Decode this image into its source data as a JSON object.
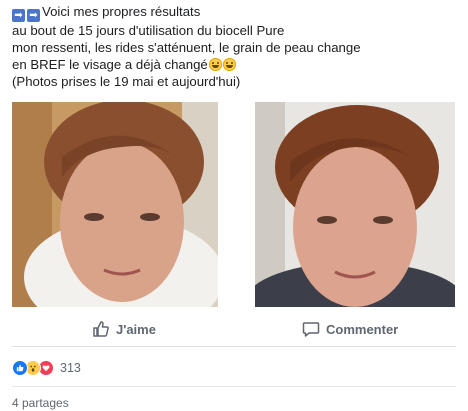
{
  "post": {
    "lines": [
      "Voici mes propres résultats",
      "au bout de 15 jours d'utilisation du biocell Pure",
      "mon ressenti, les rides s'atténuent, le grain de peau change",
      "en BREF le visage a déjà changé",
      "(Photos prises le 19 mai et aujourd'hui)"
    ],
    "arrow_icons": [
      "right-arrow-icon",
      "right-arrow-icon"
    ],
    "emoji_icons": [
      "grinning-face-icon",
      "grinning-face-icon"
    ]
  },
  "photos": [
    {
      "name": "before-photo",
      "alt": "selfie"
    },
    {
      "name": "after-photo",
      "alt": "selfie"
    }
  ],
  "actions": {
    "like_label": "J'aime",
    "comment_label": "Commenter"
  },
  "reactions": {
    "icons": [
      "like-reaction-icon",
      "wow-reaction-icon",
      "love-reaction-icon"
    ],
    "count": "313"
  },
  "shares": {
    "label": "4 partages"
  },
  "colors": {
    "facebook_blue": "#1877f2",
    "text_secondary": "#606770"
  }
}
